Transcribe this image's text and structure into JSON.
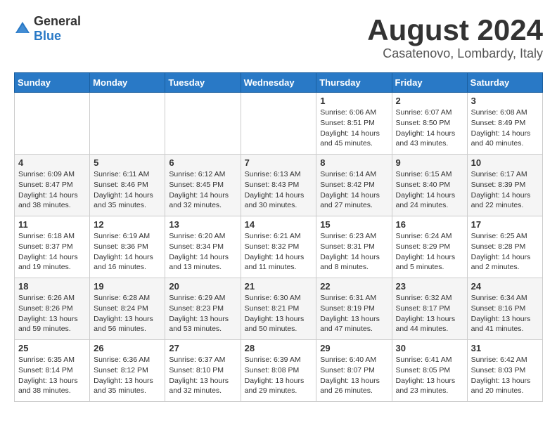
{
  "header": {
    "logo_general": "General",
    "logo_blue": "Blue",
    "title": "August 2024",
    "subtitle": "Casatenovo, Lombardy, Italy"
  },
  "calendar": {
    "days_of_week": [
      "Sunday",
      "Monday",
      "Tuesday",
      "Wednesday",
      "Thursday",
      "Friday",
      "Saturday"
    ],
    "weeks": [
      [
        {
          "day": "",
          "detail": ""
        },
        {
          "day": "",
          "detail": ""
        },
        {
          "day": "",
          "detail": ""
        },
        {
          "day": "",
          "detail": ""
        },
        {
          "day": "1",
          "detail": "Sunrise: 6:06 AM\nSunset: 8:51 PM\nDaylight: 14 hours\nand 45 minutes."
        },
        {
          "day": "2",
          "detail": "Sunrise: 6:07 AM\nSunset: 8:50 PM\nDaylight: 14 hours\nand 43 minutes."
        },
        {
          "day": "3",
          "detail": "Sunrise: 6:08 AM\nSunset: 8:49 PM\nDaylight: 14 hours\nand 40 minutes."
        }
      ],
      [
        {
          "day": "4",
          "detail": "Sunrise: 6:09 AM\nSunset: 8:47 PM\nDaylight: 14 hours\nand 38 minutes."
        },
        {
          "day": "5",
          "detail": "Sunrise: 6:11 AM\nSunset: 8:46 PM\nDaylight: 14 hours\nand 35 minutes."
        },
        {
          "day": "6",
          "detail": "Sunrise: 6:12 AM\nSunset: 8:45 PM\nDaylight: 14 hours\nand 32 minutes."
        },
        {
          "day": "7",
          "detail": "Sunrise: 6:13 AM\nSunset: 8:43 PM\nDaylight: 14 hours\nand 30 minutes."
        },
        {
          "day": "8",
          "detail": "Sunrise: 6:14 AM\nSunset: 8:42 PM\nDaylight: 14 hours\nand 27 minutes."
        },
        {
          "day": "9",
          "detail": "Sunrise: 6:15 AM\nSunset: 8:40 PM\nDaylight: 14 hours\nand 24 minutes."
        },
        {
          "day": "10",
          "detail": "Sunrise: 6:17 AM\nSunset: 8:39 PM\nDaylight: 14 hours\nand 22 minutes."
        }
      ],
      [
        {
          "day": "11",
          "detail": "Sunrise: 6:18 AM\nSunset: 8:37 PM\nDaylight: 14 hours\nand 19 minutes."
        },
        {
          "day": "12",
          "detail": "Sunrise: 6:19 AM\nSunset: 8:36 PM\nDaylight: 14 hours\nand 16 minutes."
        },
        {
          "day": "13",
          "detail": "Sunrise: 6:20 AM\nSunset: 8:34 PM\nDaylight: 14 hours\nand 13 minutes."
        },
        {
          "day": "14",
          "detail": "Sunrise: 6:21 AM\nSunset: 8:32 PM\nDaylight: 14 hours\nand 11 minutes."
        },
        {
          "day": "15",
          "detail": "Sunrise: 6:23 AM\nSunset: 8:31 PM\nDaylight: 14 hours\nand 8 minutes."
        },
        {
          "day": "16",
          "detail": "Sunrise: 6:24 AM\nSunset: 8:29 PM\nDaylight: 14 hours\nand 5 minutes."
        },
        {
          "day": "17",
          "detail": "Sunrise: 6:25 AM\nSunset: 8:28 PM\nDaylight: 14 hours\nand 2 minutes."
        }
      ],
      [
        {
          "day": "18",
          "detail": "Sunrise: 6:26 AM\nSunset: 8:26 PM\nDaylight: 13 hours\nand 59 minutes."
        },
        {
          "day": "19",
          "detail": "Sunrise: 6:28 AM\nSunset: 8:24 PM\nDaylight: 13 hours\nand 56 minutes."
        },
        {
          "day": "20",
          "detail": "Sunrise: 6:29 AM\nSunset: 8:23 PM\nDaylight: 13 hours\nand 53 minutes."
        },
        {
          "day": "21",
          "detail": "Sunrise: 6:30 AM\nSunset: 8:21 PM\nDaylight: 13 hours\nand 50 minutes."
        },
        {
          "day": "22",
          "detail": "Sunrise: 6:31 AM\nSunset: 8:19 PM\nDaylight: 13 hours\nand 47 minutes."
        },
        {
          "day": "23",
          "detail": "Sunrise: 6:32 AM\nSunset: 8:17 PM\nDaylight: 13 hours\nand 44 minutes."
        },
        {
          "day": "24",
          "detail": "Sunrise: 6:34 AM\nSunset: 8:16 PM\nDaylight: 13 hours\nand 41 minutes."
        }
      ],
      [
        {
          "day": "25",
          "detail": "Sunrise: 6:35 AM\nSunset: 8:14 PM\nDaylight: 13 hours\nand 38 minutes."
        },
        {
          "day": "26",
          "detail": "Sunrise: 6:36 AM\nSunset: 8:12 PM\nDaylight: 13 hours\nand 35 minutes."
        },
        {
          "day": "27",
          "detail": "Sunrise: 6:37 AM\nSunset: 8:10 PM\nDaylight: 13 hours\nand 32 minutes."
        },
        {
          "day": "28",
          "detail": "Sunrise: 6:39 AM\nSunset: 8:08 PM\nDaylight: 13 hours\nand 29 minutes."
        },
        {
          "day": "29",
          "detail": "Sunrise: 6:40 AM\nSunset: 8:07 PM\nDaylight: 13 hours\nand 26 minutes."
        },
        {
          "day": "30",
          "detail": "Sunrise: 6:41 AM\nSunset: 8:05 PM\nDaylight: 13 hours\nand 23 minutes."
        },
        {
          "day": "31",
          "detail": "Sunrise: 6:42 AM\nSunset: 8:03 PM\nDaylight: 13 hours\nand 20 minutes."
        }
      ]
    ]
  }
}
